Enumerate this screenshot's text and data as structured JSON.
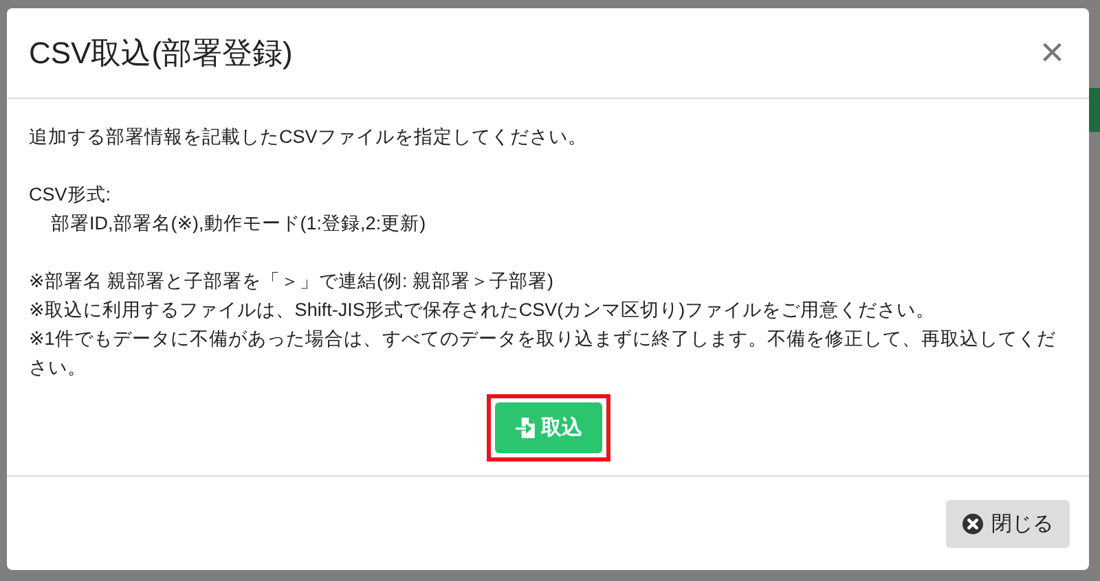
{
  "dialog": {
    "title": "CSV取込(部署登録)",
    "close_icon": "×"
  },
  "body": {
    "intro": "追加する部署情報を記載したCSVファイルを指定してください。",
    "format_label": "CSV形式:",
    "format_value": "部署ID,部署名(※),動作モード(1:登録,2:更新)",
    "notes": [
      "※部署名 親部署と子部署を「＞」で連結(例: 親部署＞子部署)",
      "※取込に利用するファイルは、Shift-JIS形式で保存されたCSV(カンマ区切り)ファイルをご用意ください。",
      "※1件でもデータに不備があった場合は、すべてのデータを取り込まずに終了します。不備を修正して、再取込してください。"
    ]
  },
  "import_button": {
    "label": "取込",
    "highlighted": true
  },
  "footer": {
    "close_button": "閉じる"
  }
}
